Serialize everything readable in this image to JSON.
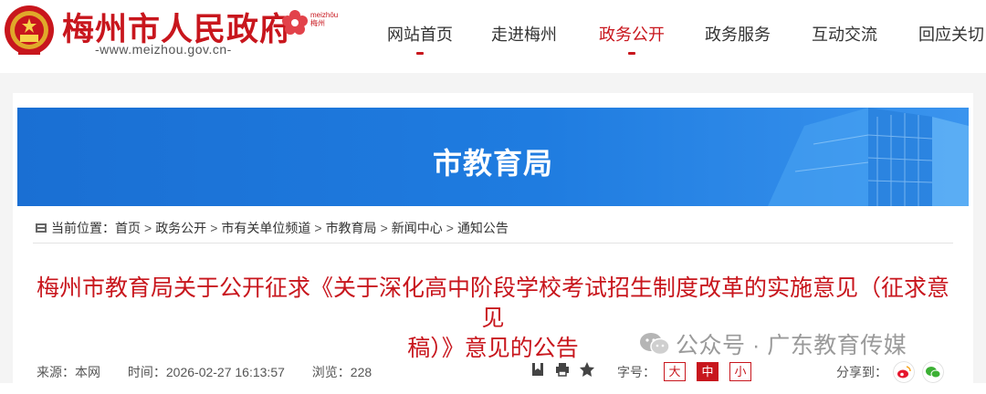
{
  "header": {
    "site_name": "梅州市人民政府",
    "site_url": "-www.meizhou.gov.cn-",
    "logo_text_top": "meizhōu",
    "logo_text_bottom": "梅州"
  },
  "nav": {
    "items": [
      {
        "label": "网站首页",
        "active": false
      },
      {
        "label": "走进梅州",
        "active": false
      },
      {
        "label": "政务公开",
        "active": true
      },
      {
        "label": "政务服务",
        "active": false
      },
      {
        "label": "互动交流",
        "active": false
      },
      {
        "label": "回应关切",
        "active": false
      }
    ]
  },
  "banner": {
    "title": "市教育局"
  },
  "breadcrumb": {
    "prefix": "当前位置：",
    "items": [
      "首页",
      "政务公开",
      "市有关单位频道",
      "市教育局",
      "新闻中心",
      "通知公告"
    ],
    "separator": ">"
  },
  "article": {
    "title_line1": "梅州市教育局关于公开征求《关于深化高中阶段学校考试招生制度改革的实施意见（征求意见",
    "title_line2": "稿）》意见的公告"
  },
  "watermark": {
    "text": "公众号 · 广东教育传媒"
  },
  "meta": {
    "source": "来源：本网",
    "time": "时间：2026-02-27 16:13:57",
    "views": "浏览：228",
    "font_label": "字号：",
    "font_large": "大",
    "font_medium": "中",
    "font_small": "小",
    "share_label": "分享到："
  },
  "colors": {
    "brand_red": "#c8161d",
    "banner_blue": "#1f7ce0"
  }
}
